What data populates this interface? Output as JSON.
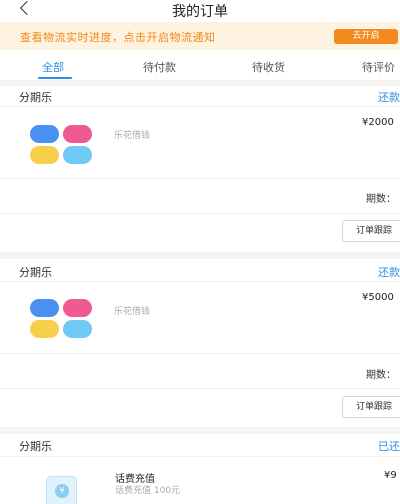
{
  "header": {
    "title": "我的订单",
    "back_icon": "chevron-left-icon"
  },
  "notice": {
    "text": "查看物流实时进度，点击开启物流通知",
    "button_label": "去开启",
    "text_color": "#f08a1c",
    "button_color": "#f28a1e"
  },
  "tabs": [
    {
      "label": "全部",
      "active": true
    },
    {
      "label": "待付款",
      "active": false
    },
    {
      "label": "待收货",
      "active": false
    },
    {
      "label": "待评价",
      "active": false
    }
  ],
  "accent_color": "#2f8fe4",
  "orders": [
    {
      "type": "分期乐",
      "status": "还款",
      "product": "乐花借钱",
      "price": "¥2000",
      "installment_label": "期数：",
      "track_label": "订单跟踪"
    },
    {
      "type": "分期乐",
      "status": "还款",
      "product": "乐花借钱",
      "price": "¥5000",
      "installment_label": "期数：",
      "track_label": "订单跟踪"
    },
    {
      "type": "分期乐",
      "status": "已还",
      "product": "话费充值",
      "description": "话费充值 100元",
      "price": "¥9"
    }
  ],
  "logo_colors": [
    "#4a90f0",
    "#f05a92",
    "#f8cf4a",
    "#6fc9f4"
  ]
}
